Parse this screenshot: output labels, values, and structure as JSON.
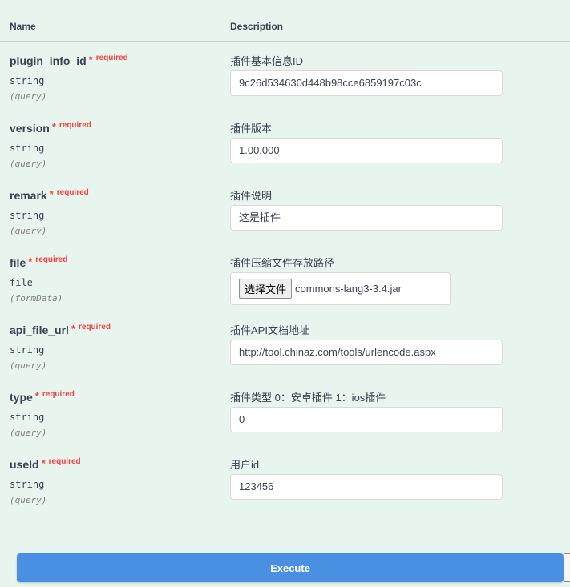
{
  "header": {
    "name": "Name",
    "description": "Description"
  },
  "params": [
    {
      "name": "plugin_info_id",
      "required": "required",
      "type": "string",
      "in": "(query)",
      "description": "插件基本信息ID",
      "value": "9c26d534630d448b98cce6859197c03c"
    },
    {
      "name": "version",
      "required": "required",
      "type": "string",
      "in": "(query)",
      "description": "插件版本",
      "value": "1.00.000"
    },
    {
      "name": "remark",
      "required": "required",
      "type": "string",
      "in": "(query)",
      "description": "插件说明",
      "value": "这是插件"
    },
    {
      "name": "file",
      "required": "required",
      "type": "file",
      "in": "(formData)",
      "description": "插件压缩文件存放路径",
      "file_button": "选择文件",
      "value": "commons-lang3-3.4.jar"
    },
    {
      "name": "api_file_url",
      "required": "required",
      "type": "string",
      "in": "(query)",
      "description": "插件API文档地址",
      "value": "http://tool.chinaz.com/tools/urlencode.aspx"
    },
    {
      "name": "type",
      "required": "required",
      "type": "string",
      "in": "(query)",
      "description": "插件类型 0：安卓插件 1：ios插件",
      "value": "0"
    },
    {
      "name": "useId",
      "required": "required",
      "type": "string",
      "in": "(query)",
      "description": "用户id",
      "value": "123456"
    }
  ],
  "execute_label": "Execute"
}
